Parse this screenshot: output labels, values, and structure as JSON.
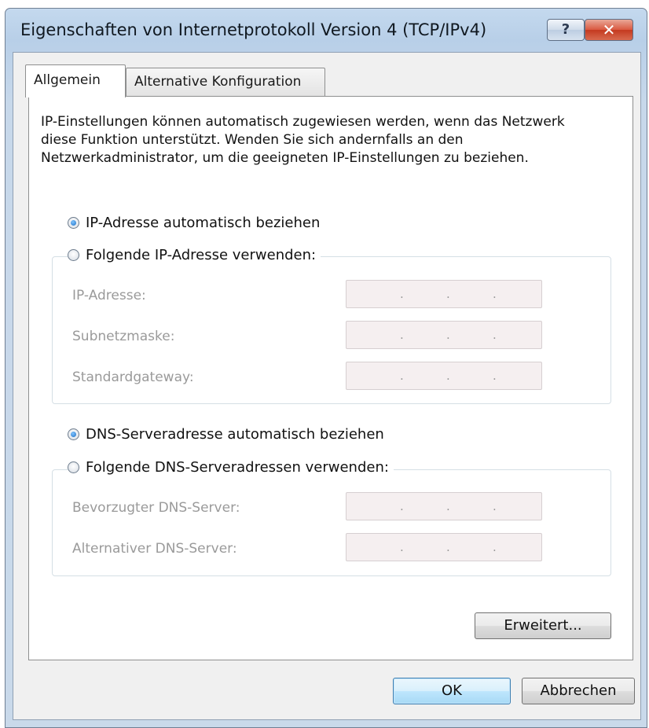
{
  "window": {
    "title": "Eigenschaften von Internetprotokoll Version 4 (TCP/IPv4)",
    "help_icon": "help-icon",
    "help_glyph": "?",
    "close_icon": "close-icon",
    "close_glyph": "✕"
  },
  "tabs": [
    {
      "label": "Allgemein",
      "selected": true
    },
    {
      "label": "Alternative Konfiguration",
      "selected": false
    }
  ],
  "intro_text": "IP-Einstellungen können automatisch zugewiesen werden, wenn das Netzwerk diese Funktion unterstützt. Wenden Sie sich andernfalls an den Netzwerkadministrator, um die geeigneten IP-Einstellungen zu beziehen.",
  "ip": {
    "auto_label": "IP-Adresse automatisch beziehen",
    "auto_selected": true,
    "manual_label": "Folgende IP-Adresse verwenden:",
    "manual_selected": false,
    "fields": [
      {
        "label": "IP-Adresse:",
        "value": ". . ."
      },
      {
        "label": "Subnetzmaske:",
        "value": ". . ."
      },
      {
        "label": "Standardgateway:",
        "value": ". . ."
      }
    ]
  },
  "dns": {
    "auto_label": "DNS-Serveradresse automatisch beziehen",
    "auto_selected": true,
    "manual_label": "Folgende DNS-Serveradressen verwenden:",
    "manual_selected": false,
    "fields": [
      {
        "label": "Bevorzugter DNS-Server:",
        "value": ". . ."
      },
      {
        "label": "Alternativer DNS-Server:",
        "value": ". . ."
      }
    ]
  },
  "buttons": {
    "advanced": "Erweitert...",
    "ok": "OK",
    "cancel": "Abbrechen"
  },
  "colors": {
    "titlebar": "#c4d9ee",
    "disabled_text": "#9a9a9a",
    "disabled_field": "#f5eff0",
    "radio_accent": "#1e6fc4"
  }
}
